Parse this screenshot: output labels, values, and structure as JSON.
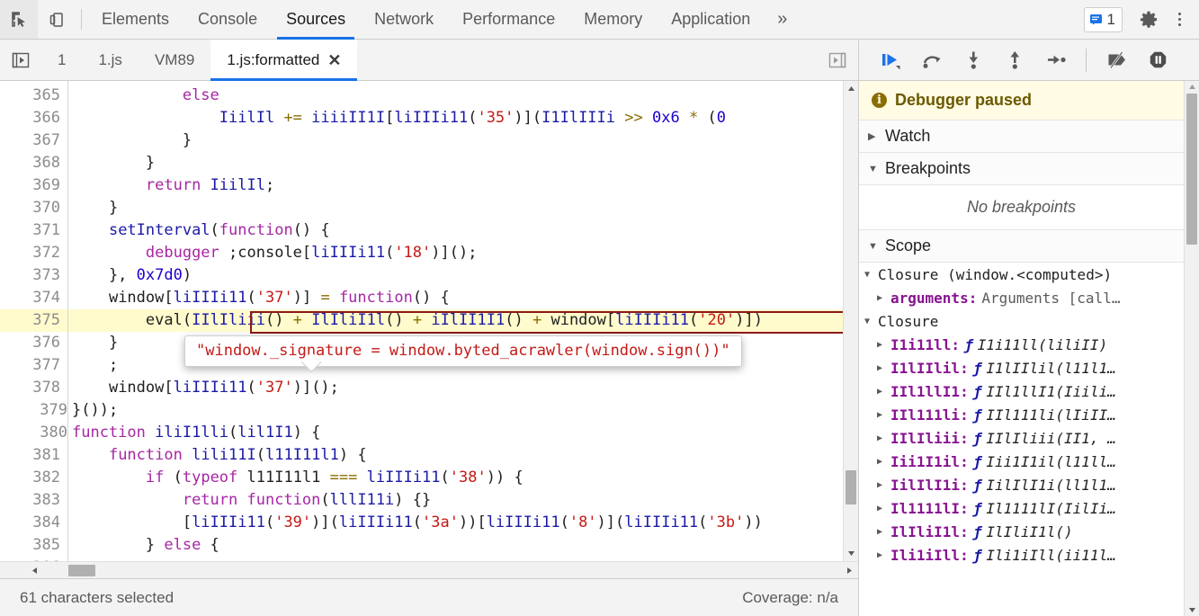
{
  "header": {
    "inspect_icon": "inspect-element-icon",
    "device_icon": "device-toolbar-icon",
    "panel_tabs": [
      {
        "label": "Elements",
        "active": false
      },
      {
        "label": "Console",
        "active": false
      },
      {
        "label": "Sources",
        "active": true
      },
      {
        "label": "Network",
        "active": false
      },
      {
        "label": "Performance",
        "active": false
      },
      {
        "label": "Memory",
        "active": false
      },
      {
        "label": "Application",
        "active": false
      }
    ],
    "more_tabs_label": "»",
    "message_count": "1",
    "message_icon": "console-message-icon",
    "settings_icon": "gear-icon",
    "kebab_icon": "more-options-icon"
  },
  "file_bar": {
    "navigator_toggle_icon": "show-navigator-icon",
    "tabs": [
      {
        "label": "1",
        "active": false,
        "closable": false
      },
      {
        "label": "1.js",
        "active": false,
        "closable": false
      },
      {
        "label": "VM89",
        "active": false,
        "closable": false
      },
      {
        "label": "1.js:formatted",
        "active": true,
        "closable": true
      }
    ],
    "close_label": "✕",
    "end_toggle_icon": "show-debugger-icon"
  },
  "editor": {
    "first_line": 365,
    "highlight_line": 375,
    "tooltip": "\"window._signature = window.byted_acrawler(window.sign())\"",
    "lines": [
      {
        "n": 365,
        "tokens": [
          {
            "t": "            ",
            "c": "plain"
          },
          {
            "t": "else",
            "c": "kw"
          }
        ]
      },
      {
        "n": 366,
        "tokens": [
          {
            "t": "                ",
            "c": "plain"
          },
          {
            "t": "IiilIl",
            "c": "ident"
          },
          {
            "t": " ",
            "c": "plain"
          },
          {
            "t": "+=",
            "c": "op"
          },
          {
            "t": " ",
            "c": "plain"
          },
          {
            "t": "iiiiII1I",
            "c": "ident"
          },
          {
            "t": "[",
            "c": "plain"
          },
          {
            "t": "liIIIi11",
            "c": "ident"
          },
          {
            "t": "(",
            "c": "plain"
          },
          {
            "t": "'35'",
            "c": "str"
          },
          {
            "t": ")](",
            "c": "plain"
          },
          {
            "t": "I1IlIIIi",
            "c": "ident"
          },
          {
            "t": " ",
            "c": "plain"
          },
          {
            "t": ">>",
            "c": "op"
          },
          {
            "t": " ",
            "c": "plain"
          },
          {
            "t": "0x6",
            "c": "num"
          },
          {
            "t": " ",
            "c": "plain"
          },
          {
            "t": "*",
            "c": "op"
          },
          {
            "t": " (",
            "c": "plain"
          },
          {
            "t": "0",
            "c": "num"
          }
        ]
      },
      {
        "n": 367,
        "tokens": [
          {
            "t": "            }",
            "c": "plain"
          }
        ]
      },
      {
        "n": 368,
        "tokens": [
          {
            "t": "        }",
            "c": "plain"
          }
        ]
      },
      {
        "n": 369,
        "tokens": [
          {
            "t": "        ",
            "c": "plain"
          },
          {
            "t": "return",
            "c": "kw"
          },
          {
            "t": " ",
            "c": "plain"
          },
          {
            "t": "IiilIl",
            "c": "ident"
          },
          {
            "t": ";",
            "c": "plain"
          }
        ]
      },
      {
        "n": 370,
        "tokens": [
          {
            "t": "    }",
            "c": "plain"
          }
        ]
      },
      {
        "n": 371,
        "tokens": [
          {
            "t": "    ",
            "c": "plain"
          },
          {
            "t": "setInterval",
            "c": "ident"
          },
          {
            "t": "(",
            "c": "plain"
          },
          {
            "t": "function",
            "c": "kw"
          },
          {
            "t": "() {",
            "c": "plain"
          }
        ]
      },
      {
        "n": 372,
        "tokens": [
          {
            "t": "        ",
            "c": "plain"
          },
          {
            "t": "debugger",
            "c": "kw"
          },
          {
            "t": " ;",
            "c": "plain"
          },
          {
            "t": "console",
            "c": "plain"
          },
          {
            "t": "[",
            "c": "plain"
          },
          {
            "t": "liIIIi11",
            "c": "ident"
          },
          {
            "t": "(",
            "c": "plain"
          },
          {
            "t": "'18'",
            "c": "str"
          },
          {
            "t": ")]();",
            "c": "plain"
          }
        ]
      },
      {
        "n": 373,
        "tokens": [
          {
            "t": "    }, ",
            "c": "plain"
          },
          {
            "t": "0x7d0",
            "c": "num"
          },
          {
            "t": ")",
            "c": "plain"
          }
        ]
      },
      {
        "n": 374,
        "tokens": [
          {
            "t": "    ",
            "c": "plain"
          },
          {
            "t": "window",
            "c": "plain"
          },
          {
            "t": "[",
            "c": "plain"
          },
          {
            "t": "liIIIi11",
            "c": "ident"
          },
          {
            "t": "(",
            "c": "plain"
          },
          {
            "t": "'37'",
            "c": "str"
          },
          {
            "t": ")] ",
            "c": "plain"
          },
          {
            "t": "=",
            "c": "op"
          },
          {
            "t": " ",
            "c": "plain"
          },
          {
            "t": "function",
            "c": "kw"
          },
          {
            "t": "() {",
            "c": "plain"
          }
        ]
      },
      {
        "n": 375,
        "tokens": [
          {
            "t": "        ",
            "c": "plain"
          },
          {
            "t": "eval",
            "c": "plain"
          },
          {
            "t": "(",
            "c": "plain"
          },
          {
            "t": "IIlIliii",
            "c": "ident"
          },
          {
            "t": "()",
            "c": "plain"
          },
          {
            "t": " ",
            "c": "plain"
          },
          {
            "t": "+",
            "c": "op"
          },
          {
            "t": " ",
            "c": "plain"
          },
          {
            "t": "IlIliI1l",
            "c": "ident"
          },
          {
            "t": "()",
            "c": "plain"
          },
          {
            "t": " ",
            "c": "plain"
          },
          {
            "t": "+",
            "c": "op"
          },
          {
            "t": " ",
            "c": "plain"
          },
          {
            "t": "iIlII1I1",
            "c": "ident"
          },
          {
            "t": "()",
            "c": "plain"
          },
          {
            "t": " ",
            "c": "plain"
          },
          {
            "t": "+",
            "c": "op"
          },
          {
            "t": " ",
            "c": "plain"
          },
          {
            "t": "window",
            "c": "plain"
          },
          {
            "t": "[",
            "c": "plain"
          },
          {
            "t": "liIIIi11",
            "c": "ident"
          },
          {
            "t": "(",
            "c": "plain"
          },
          {
            "t": "'20'",
            "c": "str"
          },
          {
            "t": ")])",
            "c": "plain"
          }
        ]
      },
      {
        "n": 376,
        "tokens": [
          {
            "t": "    }",
            "c": "plain"
          }
        ]
      },
      {
        "n": 377,
        "tokens": [
          {
            "t": "    ;",
            "c": "plain"
          }
        ]
      },
      {
        "n": 378,
        "tokens": [
          {
            "t": "    ",
            "c": "plain"
          },
          {
            "t": "window",
            "c": "plain"
          },
          {
            "t": "[",
            "c": "plain"
          },
          {
            "t": "liIIIi11",
            "c": "ident"
          },
          {
            "t": "(",
            "c": "plain"
          },
          {
            "t": "'37'",
            "c": "str"
          },
          {
            "t": ")]();",
            "c": "plain"
          }
        ]
      },
      {
        "n": 379,
        "tokens": [
          {
            "t": "}());",
            "c": "plain"
          }
        ]
      },
      {
        "n": 380,
        "tokens": [
          {
            "t": "function",
            "c": "kw"
          },
          {
            "t": " ",
            "c": "plain"
          },
          {
            "t": "iliI1lli",
            "c": "ident"
          },
          {
            "t": "(",
            "c": "plain"
          },
          {
            "t": "lil1I1",
            "c": "ident"
          },
          {
            "t": ") {",
            "c": "plain"
          }
        ]
      },
      {
        "n": 381,
        "tokens": [
          {
            "t": "    ",
            "c": "plain"
          },
          {
            "t": "function",
            "c": "kw"
          },
          {
            "t": " ",
            "c": "plain"
          },
          {
            "t": "lili11I",
            "c": "ident"
          },
          {
            "t": "(",
            "c": "plain"
          },
          {
            "t": "l11I11l1",
            "c": "ident"
          },
          {
            "t": ") {",
            "c": "plain"
          }
        ]
      },
      {
        "n": 382,
        "tokens": [
          {
            "t": "        ",
            "c": "plain"
          },
          {
            "t": "if",
            "c": "kw"
          },
          {
            "t": " (",
            "c": "plain"
          },
          {
            "t": "typeof",
            "c": "kw"
          },
          {
            "t": " ",
            "c": "plain"
          },
          {
            "t": "l11I11l1",
            "c": "plain"
          },
          {
            "t": " ",
            "c": "plain"
          },
          {
            "t": "===",
            "c": "op"
          },
          {
            "t": " ",
            "c": "plain"
          },
          {
            "t": "liIIIi11",
            "c": "ident"
          },
          {
            "t": "(",
            "c": "plain"
          },
          {
            "t": "'38'",
            "c": "str"
          },
          {
            "t": ")) {",
            "c": "plain"
          }
        ]
      },
      {
        "n": 383,
        "tokens": [
          {
            "t": "            ",
            "c": "plain"
          },
          {
            "t": "return",
            "c": "kw"
          },
          {
            "t": " ",
            "c": "plain"
          },
          {
            "t": "function",
            "c": "kw"
          },
          {
            "t": "(",
            "c": "plain"
          },
          {
            "t": "lllI11i",
            "c": "ident"
          },
          {
            "t": ") {}",
            "c": "plain"
          }
        ]
      },
      {
        "n": 384,
        "tokens": [
          {
            "t": "            [",
            "c": "plain"
          },
          {
            "t": "liIIIi11",
            "c": "ident"
          },
          {
            "t": "(",
            "c": "plain"
          },
          {
            "t": "'39'",
            "c": "str"
          },
          {
            "t": ")](",
            "c": "plain"
          },
          {
            "t": "liIIIi11",
            "c": "ident"
          },
          {
            "t": "(",
            "c": "plain"
          },
          {
            "t": "'3a'",
            "c": "str"
          },
          {
            "t": "))[",
            "c": "plain"
          },
          {
            "t": "liIIIi11",
            "c": "ident"
          },
          {
            "t": "(",
            "c": "plain"
          },
          {
            "t": "'8'",
            "c": "str"
          },
          {
            "t": ")](",
            "c": "plain"
          },
          {
            "t": "liIIIi11",
            "c": "ident"
          },
          {
            "t": "(",
            "c": "plain"
          },
          {
            "t": "'3b'",
            "c": "str"
          },
          {
            "t": "))",
            "c": "plain"
          }
        ]
      },
      {
        "n": 385,
        "tokens": [
          {
            "t": "        } ",
            "c": "plain"
          },
          {
            "t": "else",
            "c": "kw"
          },
          {
            "t": " {",
            "c": "plain"
          }
        ]
      },
      {
        "n": 386,
        "tokens": [
          {
            "t": "",
            "c": "plain"
          }
        ]
      }
    ]
  },
  "status": {
    "selection": "61 characters selected",
    "coverage": "Coverage: n/a"
  },
  "debugger": {
    "controls": [
      {
        "name": "resume-script-execution",
        "icon": "resume-icon"
      },
      {
        "name": "step-over-next-function-call",
        "icon": "step-over-icon"
      },
      {
        "name": "step-into-next-function-call",
        "icon": "step-into-icon"
      },
      {
        "name": "step-out-of-current-function",
        "icon": "step-out-icon"
      },
      {
        "name": "step",
        "icon": "step-icon"
      },
      {
        "name": "deactivate-breakpoints",
        "icon": "deactivate-breakpoints-icon"
      },
      {
        "name": "pause-on-exceptions",
        "icon": "pause-on-exceptions-icon"
      }
    ],
    "paused_banner": {
      "icon_label": "i",
      "text": "Debugger paused"
    },
    "sections": [
      {
        "name": "watch",
        "label": "Watch",
        "expanded": false
      },
      {
        "name": "breakpoints",
        "label": "Breakpoints",
        "expanded": true,
        "empty_text": "No breakpoints"
      },
      {
        "name": "scope",
        "label": "Scope",
        "expanded": true
      }
    ],
    "scope": [
      {
        "level": 1,
        "type": "closure",
        "name": "Closure (window.<computed>)",
        "expanded": true
      },
      {
        "level": 2,
        "type": "prop",
        "prop": "arguments",
        "value": "Arguments [call…",
        "expanded": false
      },
      {
        "level": 1,
        "type": "closure",
        "name": "Closure",
        "expanded": true
      },
      {
        "level": 2,
        "type": "fn",
        "prop": "I1i11ll",
        "fn": "I1i11ll(liliII)",
        "expanded": false
      },
      {
        "level": 2,
        "type": "fn",
        "prop": "I1lIIlil",
        "fn": "I1lIIlil(l11l1…",
        "expanded": false
      },
      {
        "level": 2,
        "type": "fn",
        "prop": "IIl1llI1",
        "fn": "IIl1llI1(Iiili…",
        "expanded": false
      },
      {
        "level": 2,
        "type": "fn",
        "prop": "IIl111li",
        "fn": "IIl111li(lIiII…",
        "expanded": false
      },
      {
        "level": 2,
        "type": "fn",
        "prop": "IIlIliii",
        "fn": "IIlIliii(II1, …",
        "expanded": false
      },
      {
        "level": 2,
        "type": "fn",
        "prop": "Iii1I1il",
        "fn": "Iii1I1il(l11ll…",
        "expanded": false
      },
      {
        "level": 2,
        "type": "fn",
        "prop": "IilIlI1i",
        "fn": "IilIlI1i(ll1l1…",
        "expanded": false
      },
      {
        "level": 2,
        "type": "fn",
        "prop": "Il1111lI",
        "fn": "Il1111lI(IilIi…",
        "expanded": false
      },
      {
        "level": 2,
        "type": "fn",
        "prop": "IlIliI1l",
        "fn": "IlIliI1l()",
        "expanded": false
      },
      {
        "level": 2,
        "type": "fn",
        "prop": "Ili1iIll",
        "fn": "Ili1iIll(ii11l…",
        "expanded": false
      }
    ],
    "tri_expanded": "▼",
    "tri_collapsed": "▶",
    "fn_marker": "ƒ"
  },
  "colors": {
    "accent": "#1a73e8",
    "toolbar_bg": "#f3f3f3",
    "highlight_line": "#fffbcc",
    "selection_border": "#8b1a1a",
    "string": "#c41a16",
    "keyword": "#a626a4",
    "identifier": "#1a1aa6",
    "property": "#881391",
    "paused_bg": "#fffbe5"
  }
}
